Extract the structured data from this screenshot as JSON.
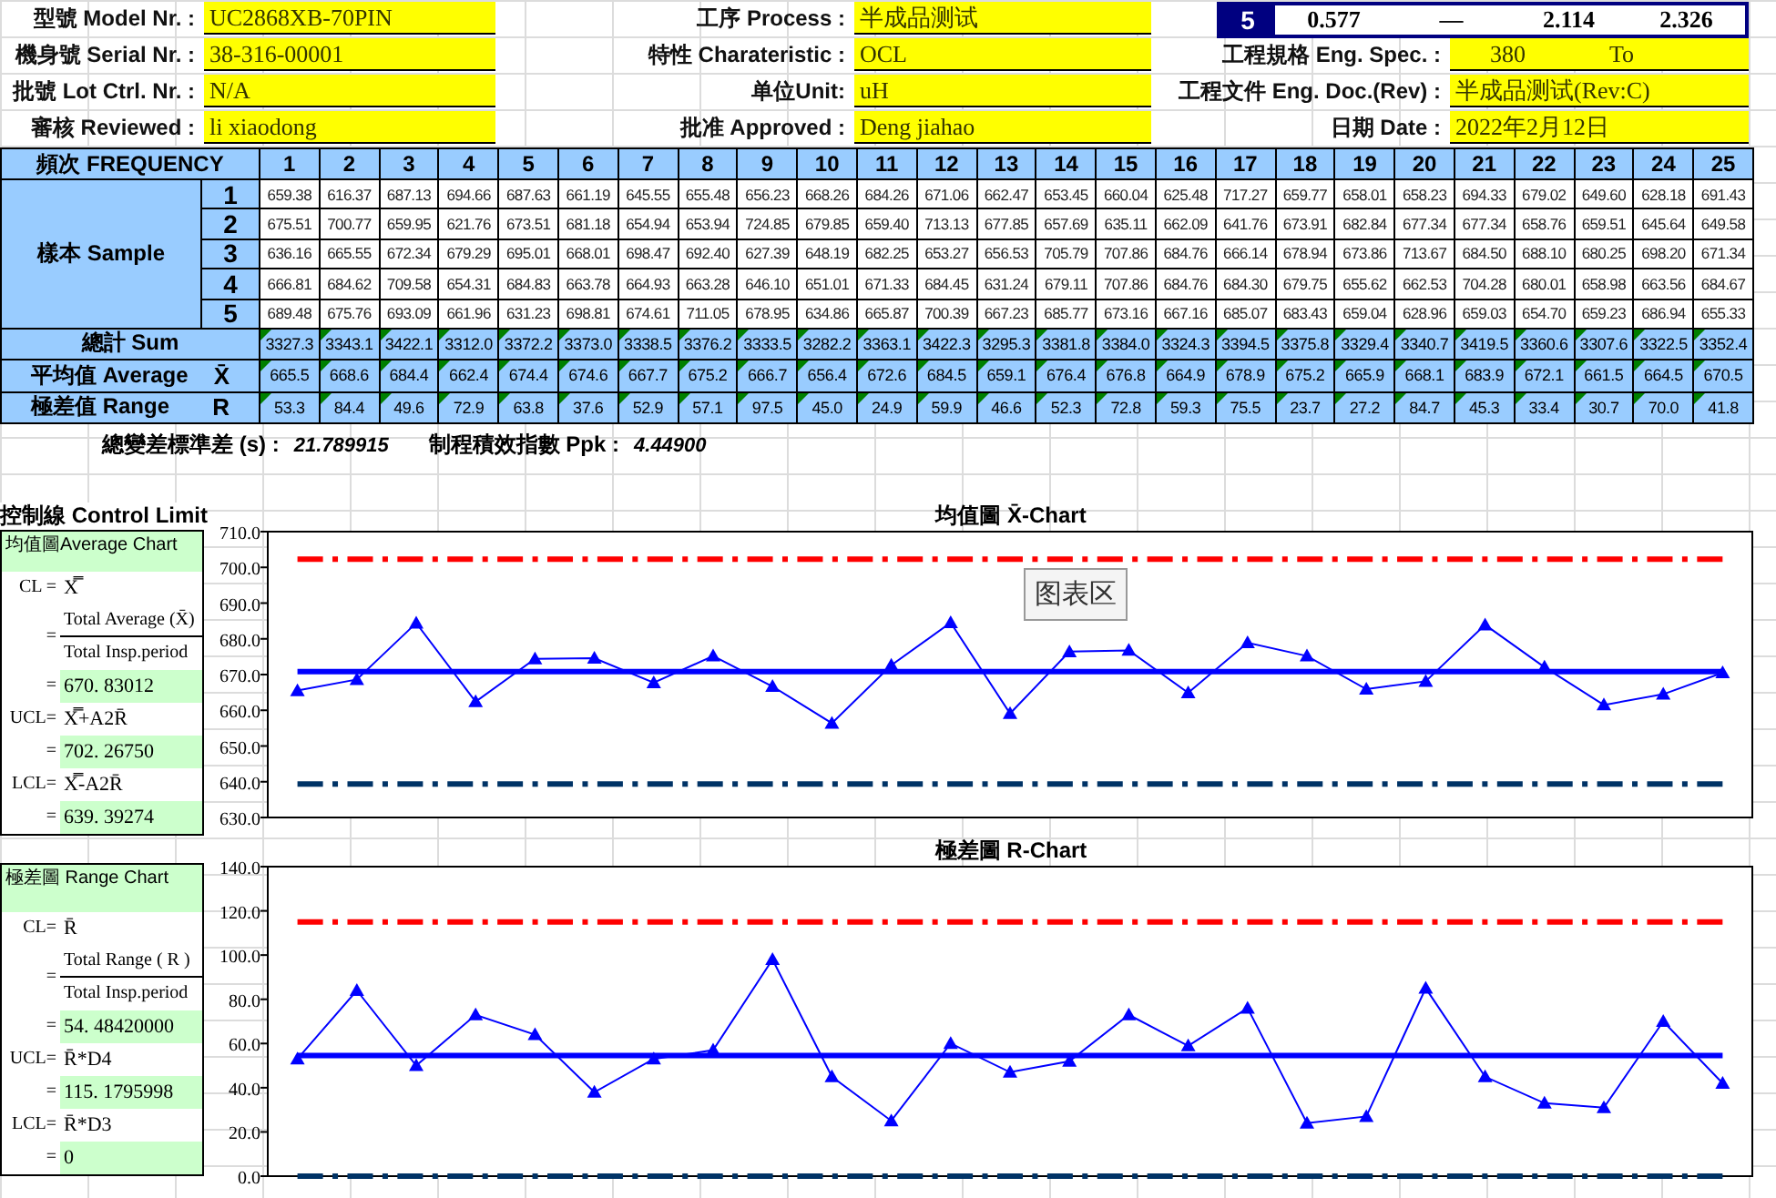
{
  "header": {
    "rows": [
      {
        "cells": [
          {
            "kind": "field",
            "label": "型號 Model Nr. :",
            "value": "UC2868XB-70PIN"
          },
          {
            "kind": "field",
            "label": "工序 Process :",
            "value": "半成品测试"
          },
          {
            "kind": "constants",
            "n": "5",
            "values": [
              "0.577",
              "—",
              "2.114",
              "2.326"
            ]
          }
        ]
      },
      {
        "cells": [
          {
            "kind": "field",
            "label": "機身號 Serial Nr. :",
            "value": "38-316-00001"
          },
          {
            "kind": "field",
            "label": "特性 Charateristic :",
            "value": "OCL"
          },
          {
            "kind": "spec",
            "label": "工程規格 Eng. Spec. :",
            "values": [
              "380",
              "To"
            ]
          }
        ]
      },
      {
        "cells": [
          {
            "kind": "field",
            "label": "批號 Lot Ctrl. Nr. :",
            "value": "N/A"
          },
          {
            "kind": "field",
            "label": "单位Unit:",
            "value": "uH"
          },
          {
            "kind": "field",
            "label": "工程文件 Eng. Doc.(Rev) :",
            "value": "半成品测试(Rev:C)"
          }
        ]
      },
      {
        "cells": [
          {
            "kind": "field",
            "label": "審核 Reviewed :",
            "value": "li xiaodong"
          },
          {
            "kind": "field",
            "label": "批准 Approved :",
            "value": "Deng jiahao"
          },
          {
            "kind": "field",
            "label": "日期 Date :",
            "value": "2022年2月12日"
          }
        ]
      }
    ]
  },
  "table": {
    "frequency_label": "頻次 FREQUENCY",
    "frequency": [
      "1",
      "2",
      "3",
      "4",
      "5",
      "6",
      "7",
      "8",
      "9",
      "10",
      "11",
      "12",
      "13",
      "14",
      "15",
      "16",
      "17",
      "18",
      "19",
      "20",
      "21",
      "22",
      "23",
      "24",
      "25"
    ],
    "sample_label": "樣本 Sample",
    "sample_rows": [
      {
        "number": "1",
        "values": [
          "659.38",
          "616.37",
          "687.13",
          "694.66",
          "687.63",
          "661.19",
          "645.55",
          "655.48",
          "656.23",
          "668.26",
          "684.26",
          "671.06",
          "662.47",
          "653.45",
          "660.04",
          "625.48",
          "717.27",
          "659.77",
          "658.01",
          "658.23",
          "694.33",
          "679.02",
          "649.60",
          "628.18",
          "691.43"
        ]
      },
      {
        "number": "2",
        "values": [
          "675.51",
          "700.77",
          "659.95",
          "621.76",
          "673.51",
          "681.18",
          "654.94",
          "653.94",
          "724.85",
          "679.85",
          "659.40",
          "713.13",
          "677.85",
          "657.69",
          "635.11",
          "662.09",
          "641.76",
          "673.91",
          "682.84",
          "677.34",
          "677.34",
          "658.76",
          "659.51",
          "645.64",
          "649.58"
        ]
      },
      {
        "number": "3",
        "values": [
          "636.16",
          "665.55",
          "672.34",
          "679.29",
          "695.01",
          "668.01",
          "698.47",
          "692.40",
          "627.39",
          "648.19",
          "682.25",
          "653.27",
          "656.53",
          "705.79",
          "707.86",
          "684.76",
          "666.14",
          "678.94",
          "673.86",
          "713.67",
          "684.50",
          "688.10",
          "680.25",
          "698.20",
          "671.34"
        ]
      },
      {
        "number": "4",
        "values": [
          "666.81",
          "684.62",
          "709.58",
          "654.31",
          "684.83",
          "663.78",
          "664.93",
          "663.28",
          "646.10",
          "651.01",
          "671.33",
          "684.45",
          "631.24",
          "679.11",
          "707.86",
          "684.76",
          "684.30",
          "679.75",
          "655.62",
          "662.53",
          "704.28",
          "680.01",
          "658.98",
          "663.56",
          "684.67"
        ]
      },
      {
        "number": "5",
        "values": [
          "689.48",
          "675.76",
          "693.09",
          "661.96",
          "631.23",
          "698.81",
          "674.61",
          "711.05",
          "678.95",
          "634.86",
          "665.87",
          "700.39",
          "667.23",
          "685.77",
          "673.16",
          "667.16",
          "685.07",
          "683.43",
          "659.04",
          "628.96",
          "659.03",
          "654.70",
          "659.23",
          "686.94",
          "655.33"
        ]
      }
    ],
    "sum_label": "總計 Sum",
    "sums": [
      "3327.3",
      "3343.1",
      "3422.1",
      "3312.0",
      "3372.2",
      "3373.0",
      "3338.5",
      "3376.2",
      "3333.5",
      "3282.2",
      "3363.1",
      "3422.3",
      "3295.3",
      "3381.8",
      "3384.0",
      "3324.3",
      "3394.5",
      "3375.8",
      "3329.4",
      "3340.7",
      "3419.5",
      "3360.6",
      "3307.6",
      "3322.5",
      "3352.4"
    ],
    "average_label": "平均值 Average",
    "average_symbol": "X̄",
    "averages": [
      "665.5",
      "668.6",
      "684.4",
      "662.4",
      "674.4",
      "674.6",
      "667.7",
      "675.2",
      "666.7",
      "656.4",
      "672.6",
      "684.5",
      "659.1",
      "676.4",
      "676.8",
      "664.9",
      "678.9",
      "675.2",
      "665.9",
      "668.1",
      "683.9",
      "672.1",
      "661.5",
      "664.5",
      "670.5"
    ],
    "range_label": "極差值 Range",
    "range_symbol": "R",
    "ranges": [
      "53.3",
      "84.4",
      "49.6",
      "72.9",
      "63.8",
      "37.6",
      "52.9",
      "57.1",
      "97.5",
      "45.0",
      "24.9",
      "59.9",
      "46.6",
      "52.3",
      "72.8",
      "59.3",
      "75.5",
      "23.7",
      "27.2",
      "84.7",
      "45.3",
      "33.4",
      "30.7",
      "70.0",
      "41.8"
    ]
  },
  "statistics": [
    {
      "label": "總變差標準差 (s) :",
      "value": "21.789915"
    },
    {
      "label": "制程積效指數 Ppk :",
      "value": "4.44900"
    }
  ],
  "control_limits": {
    "title": "控制線 Control Limit",
    "panels": [
      {
        "rows": [
          {
            "kind": "title",
            "text": "均值圖Average Chart"
          },
          {
            "kind": "formula",
            "label": "CL =",
            "expr": "X̿"
          },
          {
            "kind": "fraction",
            "eq": "=",
            "num": "Total Average (X̄)",
            "den": "Total Insp.period"
          },
          {
            "kind": "value",
            "eq": "=",
            "value": "670. 83012"
          },
          {
            "kind": "formula",
            "label": "UCL=",
            "expr": "X̿+A2R̄"
          },
          {
            "kind": "value",
            "eq": "=",
            "value": "702. 26750"
          },
          {
            "kind": "formula",
            "label": "LCL=",
            "expr": "X̿-A2R̄"
          },
          {
            "kind": "value",
            "eq": "=",
            "value": "639. 39274"
          }
        ]
      },
      {
        "rows": [
          {
            "kind": "title",
            "text": "極差圖 Range Chart"
          },
          {
            "kind": "formula",
            "label": "CL=",
            "expr": "R̄"
          },
          {
            "kind": "fraction",
            "eq": "=",
            "num": "Total Range ( R )",
            "den": "Total Insp.period"
          },
          {
            "kind": "value",
            "eq": "=",
            "value": "54. 48420000"
          },
          {
            "kind": "formula",
            "label": "UCL=",
            "expr": "R̄*D4"
          },
          {
            "kind": "value",
            "eq": "=",
            "value": "115. 1795998"
          },
          {
            "kind": "formula",
            "label": "LCL=",
            "expr": "R̄*D3"
          },
          {
            "kind": "value",
            "eq": "=",
            "value": "0"
          }
        ]
      }
    ]
  },
  "charts": [
    {
      "tooltip": "图表区",
      "chart_data": {
        "type": "line",
        "title": "均值圖 X̄-Chart",
        "ylim": [
          630,
          710
        ],
        "yticks": [
          {
            "value": 630,
            "label": "630.0"
          },
          {
            "value": 640,
            "label": "640.0"
          },
          {
            "value": 650,
            "label": "650.0"
          },
          {
            "value": 660,
            "label": "660.0"
          },
          {
            "value": 670,
            "label": "670.0"
          },
          {
            "value": 680,
            "label": "680.0"
          },
          {
            "value": 690,
            "label": "690.0"
          },
          {
            "value": 700,
            "label": "700.0"
          },
          {
            "value": 710,
            "label": "710.0"
          }
        ],
        "series": [
          {
            "color": "#0000ff",
            "marker": "triangle",
            "values": [
              665.5,
              668.6,
              684.4,
              662.4,
              674.4,
              674.6,
              667.7,
              675.2,
              666.7,
              656.4,
              672.6,
              684.5,
              659.1,
              676.4,
              676.8,
              664.9,
              678.9,
              675.2,
              665.9,
              668.1,
              683.9,
              672.1,
              661.5,
              664.5,
              670.5
            ]
          },
          {
            "color": "#ff0000",
            "line_style": "dashdot",
            "values": [
              702.3,
              702.3,
              702.3,
              702.3,
              702.3,
              702.3,
              702.3,
              702.3,
              702.3,
              702.3,
              702.3,
              702.3,
              702.3,
              702.3,
              702.3,
              702.3,
              702.3,
              702.3,
              702.3,
              702.3,
              702.3,
              702.3,
              702.3,
              702.3,
              702.3
            ]
          },
          {
            "color": "#0000ff",
            "line_style": "solid",
            "values": [
              670.8,
              670.8,
              670.8,
              670.8,
              670.8,
              670.8,
              670.8,
              670.8,
              670.8,
              670.8,
              670.8,
              670.8,
              670.8,
              670.8,
              670.8,
              670.8,
              670.8,
              670.8,
              670.8,
              670.8,
              670.8,
              670.8,
              670.8,
              670.8,
              670.8
            ]
          },
          {
            "color": "#003366",
            "line_style": "dashdot",
            "values": [
              639.4,
              639.4,
              639.4,
              639.4,
              639.4,
              639.4,
              639.4,
              639.4,
              639.4,
              639.4,
              639.4,
              639.4,
              639.4,
              639.4,
              639.4,
              639.4,
              639.4,
              639.4,
              639.4,
              639.4,
              639.4,
              639.4,
              639.4,
              639.4,
              639.4
            ]
          }
        ]
      }
    },
    {
      "chart_data": {
        "type": "line",
        "title": "極差圖 R-Chart",
        "ylim": [
          0,
          140
        ],
        "yticks": [
          {
            "value": 0,
            "label": "0.0"
          },
          {
            "value": 20,
            "label": "20.0"
          },
          {
            "value": 40,
            "label": "40.0"
          },
          {
            "value": 60,
            "label": "60.0"
          },
          {
            "value": 80,
            "label": "80.0"
          },
          {
            "value": 100,
            "label": "100.0"
          },
          {
            "value": 120,
            "label": "120.0"
          },
          {
            "value": 140,
            "label": "140.0"
          }
        ],
        "series": [
          {
            "color": "#0000ff",
            "marker": "triangle",
            "values": [
              53,
              84,
              50,
              73,
              64,
              38,
              53,
              57,
              98,
              45,
              25,
              60,
              47,
              52,
              73,
              59,
              76,
              24,
              27,
              85,
              45,
              33,
              31,
              70,
              42
            ]
          },
          {
            "color": "#ff0000",
            "line_style": "dashdot",
            "values": [
              115,
              115,
              115,
              115,
              115,
              115,
              115,
              115,
              115,
              115,
              115,
              115,
              115,
              115,
              115,
              115,
              115,
              115,
              115,
              115,
              115,
              115,
              115,
              115,
              115
            ]
          },
          {
            "color": "#0000ff",
            "line_style": "solid",
            "values": [
              54.5,
              54.5,
              54.5,
              54.5,
              54.5,
              54.5,
              54.5,
              54.5,
              54.5,
              54.5,
              54.5,
              54.5,
              54.5,
              54.5,
              54.5,
              54.5,
              54.5,
              54.5,
              54.5,
              54.5,
              54.5,
              54.5,
              54.5,
              54.5,
              54.5
            ]
          },
          {
            "color": "#003366",
            "line_style": "dashdot",
            "values": [
              0,
              0,
              0,
              0,
              0,
              0,
              0,
              0,
              0,
              0,
              0,
              0,
              0,
              0,
              0,
              0,
              0,
              0,
              0,
              0,
              0,
              0,
              0,
              0,
              0
            ]
          }
        ]
      }
    }
  ]
}
